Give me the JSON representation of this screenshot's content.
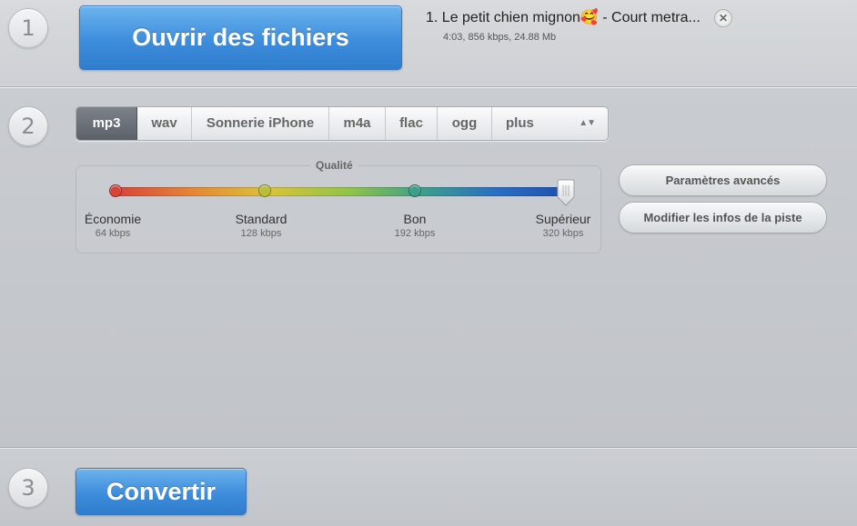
{
  "steps": {
    "one": "1",
    "two": "2",
    "three": "3"
  },
  "open_button": {
    "label": "Ouvrir des fichiers"
  },
  "file": {
    "name": "1. Le petit chien mignon🥰 - Court metra...",
    "meta": "4:03, 856 kbps, 24.88 Mb",
    "remove_icon": "close-icon"
  },
  "formats": {
    "tabs": [
      "mp3",
      "wav",
      "Sonnerie iPhone",
      "m4a",
      "flac",
      "ogg",
      "plus"
    ],
    "active": "mp3"
  },
  "quality": {
    "title": "Qualité",
    "levels": [
      {
        "name": "Économie",
        "kbps": "64 kbps"
      },
      {
        "name": "Standard",
        "kbps": "128 kbps"
      },
      {
        "name": "Bon",
        "kbps": "192 kbps"
      },
      {
        "name": "Supérieur",
        "kbps": "320 kbps"
      }
    ],
    "selected_index": 3
  },
  "side_buttons": {
    "advanced": "Paramètres avancés",
    "tags": "Modifier les infos de la piste"
  },
  "convert_button": {
    "label": "Convertir"
  },
  "colors": {
    "primary_button": "#3e8ddc",
    "stop_economie": "#d8433a",
    "stop_standard": "#b8c03a",
    "stop_bon": "#3c9e8b"
  }
}
